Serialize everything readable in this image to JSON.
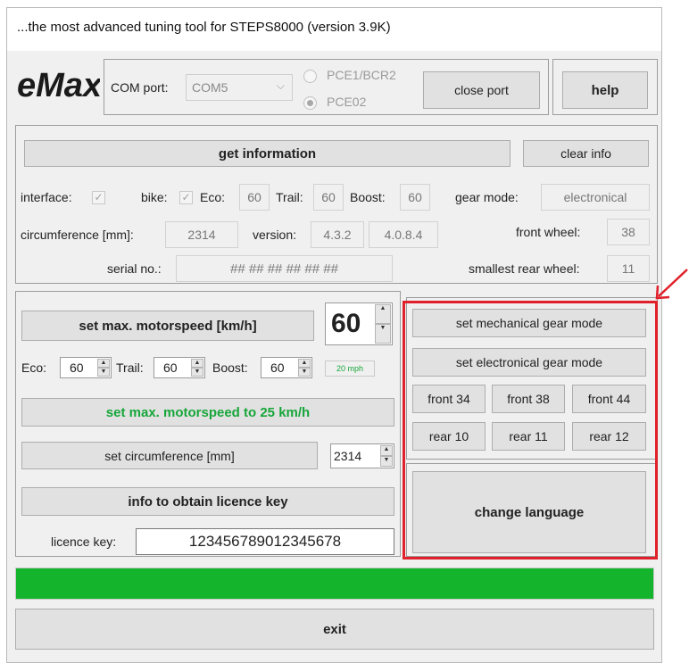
{
  "window": {
    "title": "...the most advanced tuning tool for STEPS8000 (version 3.9K)"
  },
  "logo": {
    "text": "eMax"
  },
  "port": {
    "com_label": "COM port:",
    "com_value": "COM5",
    "radio1": "PCE1/BCR2",
    "radio2": "PCE02",
    "close_port": "close port",
    "help": "help"
  },
  "info": {
    "get_information": "get information",
    "clear_info": "clear info",
    "interface_label": "interface:",
    "bike_label": "bike:",
    "eco_label": "Eco:",
    "eco_value": "60",
    "trail_label": "Trail:",
    "trail_value": "60",
    "boost_label": "Boost:",
    "boost_value": "60",
    "gear_mode_label": "gear mode:",
    "gear_mode_value": "electronical",
    "circumference_label": "circumference [mm]:",
    "circumference_value": "2314",
    "version_label": "version:",
    "version_value1": "4.3.2",
    "version_value2": "4.0.8.4",
    "front_wheel_label": "front wheel:",
    "front_wheel_value": "38",
    "serial_label": "serial no.:",
    "serial_value": "## ## ## ## ## ##",
    "smallest_rear_label": "smallest rear wheel:",
    "smallest_rear_value": "11"
  },
  "motor": {
    "set_max_label": "set max. motorspeed [km/h]",
    "max_value": "60",
    "eco_label": "Eco:",
    "eco_value": "60",
    "trail_label": "Trail:",
    "trail_value": "60",
    "boost_label": "Boost:",
    "boost_value": "60",
    "mph_badge": "20 mph",
    "set_25_label": "set max. motorspeed to 25 km/h",
    "set_circ_label": "set circumference [mm]",
    "circ_value": "2314",
    "licence_info_label": "info to obtain licence key",
    "licence_key_label": "licence key:",
    "licence_key_value": "123456789012345678"
  },
  "gear": {
    "mechanical": "set mechanical gear mode",
    "electronical": "set electronical gear mode",
    "front34": "front 34",
    "front38": "front 38",
    "front44": "front 44",
    "rear10": "rear 10",
    "rear11": "rear 11",
    "rear12": "rear 12",
    "change_language": "change language"
  },
  "progress": {
    "fraction": 1.0,
    "color": "#14b42c"
  },
  "exit": {
    "label": "exit"
  },
  "colors": {
    "highlight": "#e0202a",
    "green_text": "#17a63a"
  }
}
